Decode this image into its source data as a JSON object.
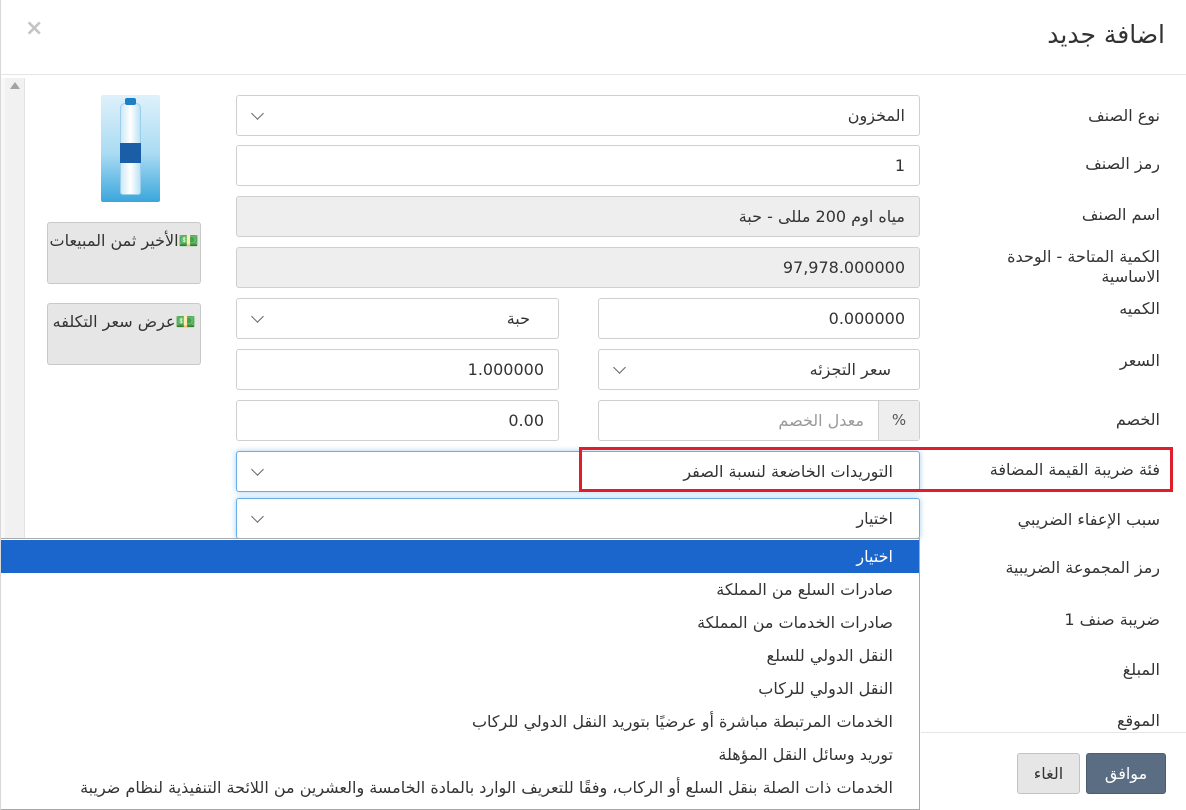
{
  "modal": {
    "title": "اضافة جديد",
    "close": "×"
  },
  "labels": {
    "item_type": "نوع الصنف",
    "item_code": "رمز الصنف",
    "item_name": "اسم الصنف",
    "available_qty": "الكمية المتاحة - الوحدة الاساسية",
    "quantity": "الكميه",
    "price": "السعر",
    "discount": "الخصم",
    "vat_category": "فئة ضريبة القيمة المضافة",
    "exemption_reason": "سبب الإعفاء الضريبي",
    "tax_group_code": "رمز المجموعة الضريبية",
    "item_tax": "ضريبة صنف 1",
    "amount": "المبلغ",
    "location": "الموقع"
  },
  "fields": {
    "item_type": "المخزون",
    "item_code": "1",
    "item_name": "مياه اوم 200 مللى - حبة",
    "available_qty": "97,978.000000",
    "quantity": "0.000000",
    "unit": "حبة",
    "price_type": "سعر التجزئه",
    "price_value": "1.000000",
    "discount_rate_placeholder": "معدل الخصم",
    "discount_addon": "%",
    "discount_value": "0.00",
    "vat_category": "التوريدات الخاضعة لنسبة الصفر",
    "exemption_reason": "اختيار"
  },
  "side_buttons": {
    "last_sales_price": "💵الأخير ثمن المبيعات",
    "cost_price": "💵عرض سعر التكلفه"
  },
  "dropdown_options": [
    "اختيار",
    "صادرات السلع من المملكة",
    "صادرات الخدمات من المملكة",
    "النقل الدولي للسلع",
    "النقل الدولي للركاب",
    "الخدمات المرتبطة مباشرة أو عرضيًا بتوريد النقل الدولي للركاب",
    "توريد وسائل النقل المؤهلة",
    "الخدمات ذات الصلة بنقل السلع أو الركاب، وفقًا للتعريف الوارد بالمادة الخامسة والعشرين من اللائحة التنفيذية لنظام ضريبة"
  ],
  "footer": {
    "ok": "موافق",
    "cancel": "الغاء"
  },
  "colors": {
    "highlight": "#e01d2a",
    "selected_option": "#1a66cc",
    "ok_button": "#5a6d82"
  }
}
